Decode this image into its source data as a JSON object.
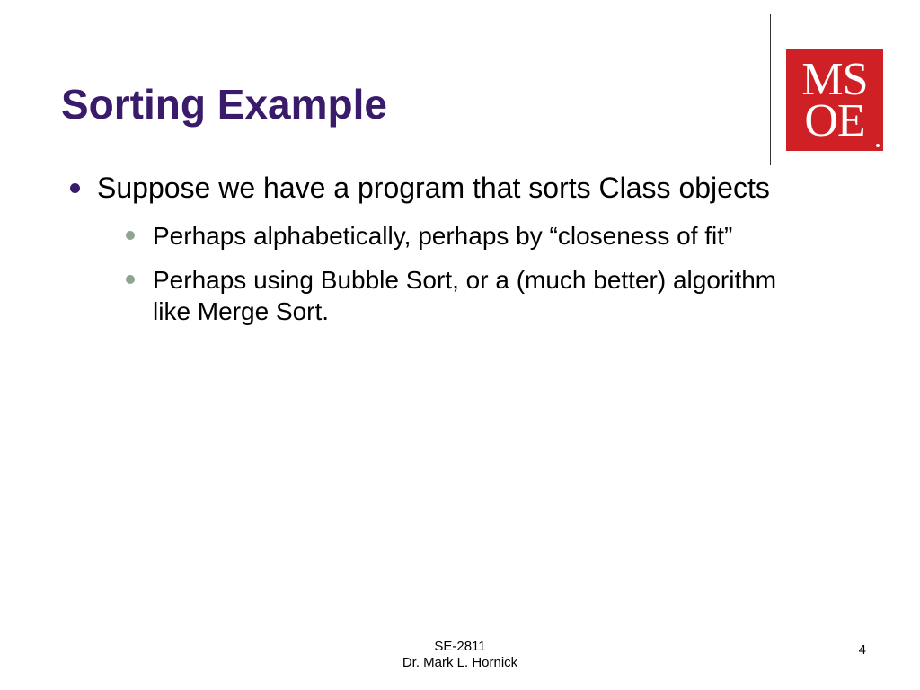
{
  "logo": {
    "line1": "MS",
    "line2": "OE"
  },
  "title": "Sorting Example",
  "bullets": {
    "main": "Suppose we have a program that sorts Class objects",
    "subs": [
      "Perhaps alphabetically, perhaps by “closeness of fit”",
      "Perhaps using Bubble Sort, or a (much better) algorithm like Merge Sort."
    ]
  },
  "footer": {
    "course": "SE-2811",
    "author": "Dr. Mark L. Hornick"
  },
  "page_number": "4"
}
